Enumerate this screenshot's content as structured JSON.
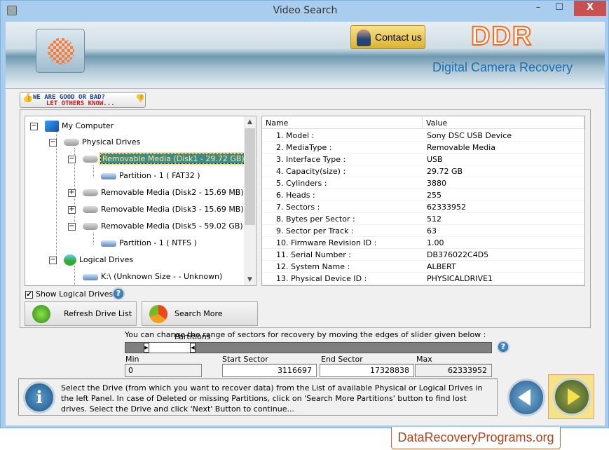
{
  "window": {
    "title": "Video Search",
    "minimize": "–",
    "maximize": "☐",
    "close": "X"
  },
  "header": {
    "contact_label": "Contact us",
    "brand": "DDR",
    "product": "Digital Camera Recovery"
  },
  "feedback": {
    "line1": "WE ARE GOOD OR BAD?",
    "line2": "LET OTHERS KNOW..."
  },
  "tree": {
    "root": "My Computer",
    "physical": "Physical Drives",
    "items": [
      "Removable Media (Disk1 - 29.72 GB)",
      "Partition - 1 ( FAT32 )",
      "Removable Media (Disk2 - 15.69 MB)",
      "Removable Media (Disk3 - 15.69 MB)",
      "Removable Media (Disk5 - 59.02 GB)",
      "Partition - 1 ( NTFS )"
    ],
    "logical": "Logical Drives",
    "logical_items": [
      "K:\\ (Unknown Size  -  - Unknown)"
    ],
    "selected": "Removable Media (Disk1 - 29.72 GB)"
  },
  "properties": {
    "columns": [
      "Name",
      "Value"
    ],
    "rows": [
      {
        "name": "1. Model :",
        "value": "Sony DSC USB Device"
      },
      {
        "name": "2. MediaType :",
        "value": "Removable Media"
      },
      {
        "name": "3. Interface Type :",
        "value": "USB"
      },
      {
        "name": "4. Capacity(size) :",
        "value": "29.72 GB"
      },
      {
        "name": "5. Cylinders :",
        "value": "3880"
      },
      {
        "name": "6. Heads :",
        "value": "255"
      },
      {
        "name": "7. Sectors :",
        "value": "62333952"
      },
      {
        "name": "8. Bytes per Sector :",
        "value": "512"
      },
      {
        "name": "9. Sector per Track :",
        "value": "63"
      },
      {
        "name": "10. Firmware Revision ID :",
        "value": "1.00"
      },
      {
        "name": "11. Serial Number :",
        "value": "DB376022C4D5"
      },
      {
        "name": "12. System Name :",
        "value": "ALBERT"
      },
      {
        "name": "13. Physical Device ID :",
        "value": "PHYSICALDRIVE1"
      }
    ]
  },
  "options": {
    "show_logical_label": "Show Logical Drives",
    "show_logical_checked": true,
    "help": "?"
  },
  "buttons": {
    "refresh": "Refresh Drive List",
    "search_more": "Search More Partitions"
  },
  "sectors": {
    "instruction": "You can change the range of sectors for recovery by moving the edges of slider given below :",
    "min_label": "Min",
    "min": "0",
    "start_label": "Start Sector",
    "start": "3116697",
    "end_label": "End Sector",
    "end": "17328838",
    "max_label": "Max",
    "max": "62333952"
  },
  "info": {
    "icon": "i",
    "text": "Select the Drive (from which you want to recover data) from the List of available Physical or Logical Drives in the left Panel. In case of Deleted or missing Partitions, click on 'Search More Partitions' button to find lost drives. Select the Drive and click 'Next' Button to continue..."
  },
  "watermark": "DataRecoveryPrograms.org"
}
